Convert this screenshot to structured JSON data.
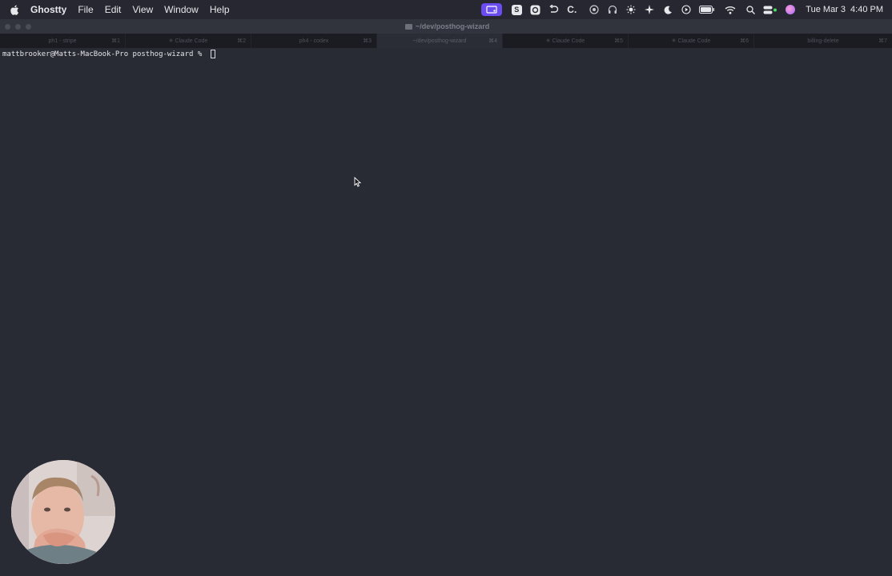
{
  "menubar": {
    "app_name": "Ghostty",
    "menus": [
      "File",
      "Edit",
      "View",
      "Window",
      "Help"
    ],
    "status_icons": [
      "screen-share-icon",
      "s-badge-icon",
      "app-badge-icon",
      "rotate-icon",
      "c-dot-icon",
      "settings-icon",
      "headphones-icon",
      "brightness-icon",
      "sparkle-icon",
      "moon-icon",
      "play-icon",
      "battery-icon",
      "wifi-icon",
      "search-icon",
      "control-center-icon",
      "profile-icon"
    ],
    "s_badge": "S",
    "c_label": "C.",
    "date": "Tue Mar 3",
    "time": "4:40 PM"
  },
  "window": {
    "title": "~/dev/posthog-wizard"
  },
  "tabs": [
    {
      "label": "ph1 - stripe",
      "shortcut": "⌘1",
      "active": false
    },
    {
      "label": "✳ Claude Code",
      "shortcut": "⌘2",
      "active": false
    },
    {
      "label": "ph4 - codex",
      "shortcut": "⌘3",
      "active": false
    },
    {
      "label": "~/dev/posthog-wizard",
      "shortcut": "⌘4",
      "active": true
    },
    {
      "label": "✳ Claude Code",
      "shortcut": "⌘5",
      "active": false
    },
    {
      "label": "✳ Claude Code",
      "shortcut": "⌘6",
      "active": false
    },
    {
      "label": "billing-delete",
      "shortcut": "⌘7",
      "active": false
    }
  ],
  "terminal": {
    "prompt": "mattbrooker@Matts-MacBook-Pro posthog-wizard % "
  },
  "colors": {
    "terminal_bg": "#282a34",
    "menubar_bg": "#262730",
    "accent": "#6a4cf0"
  }
}
